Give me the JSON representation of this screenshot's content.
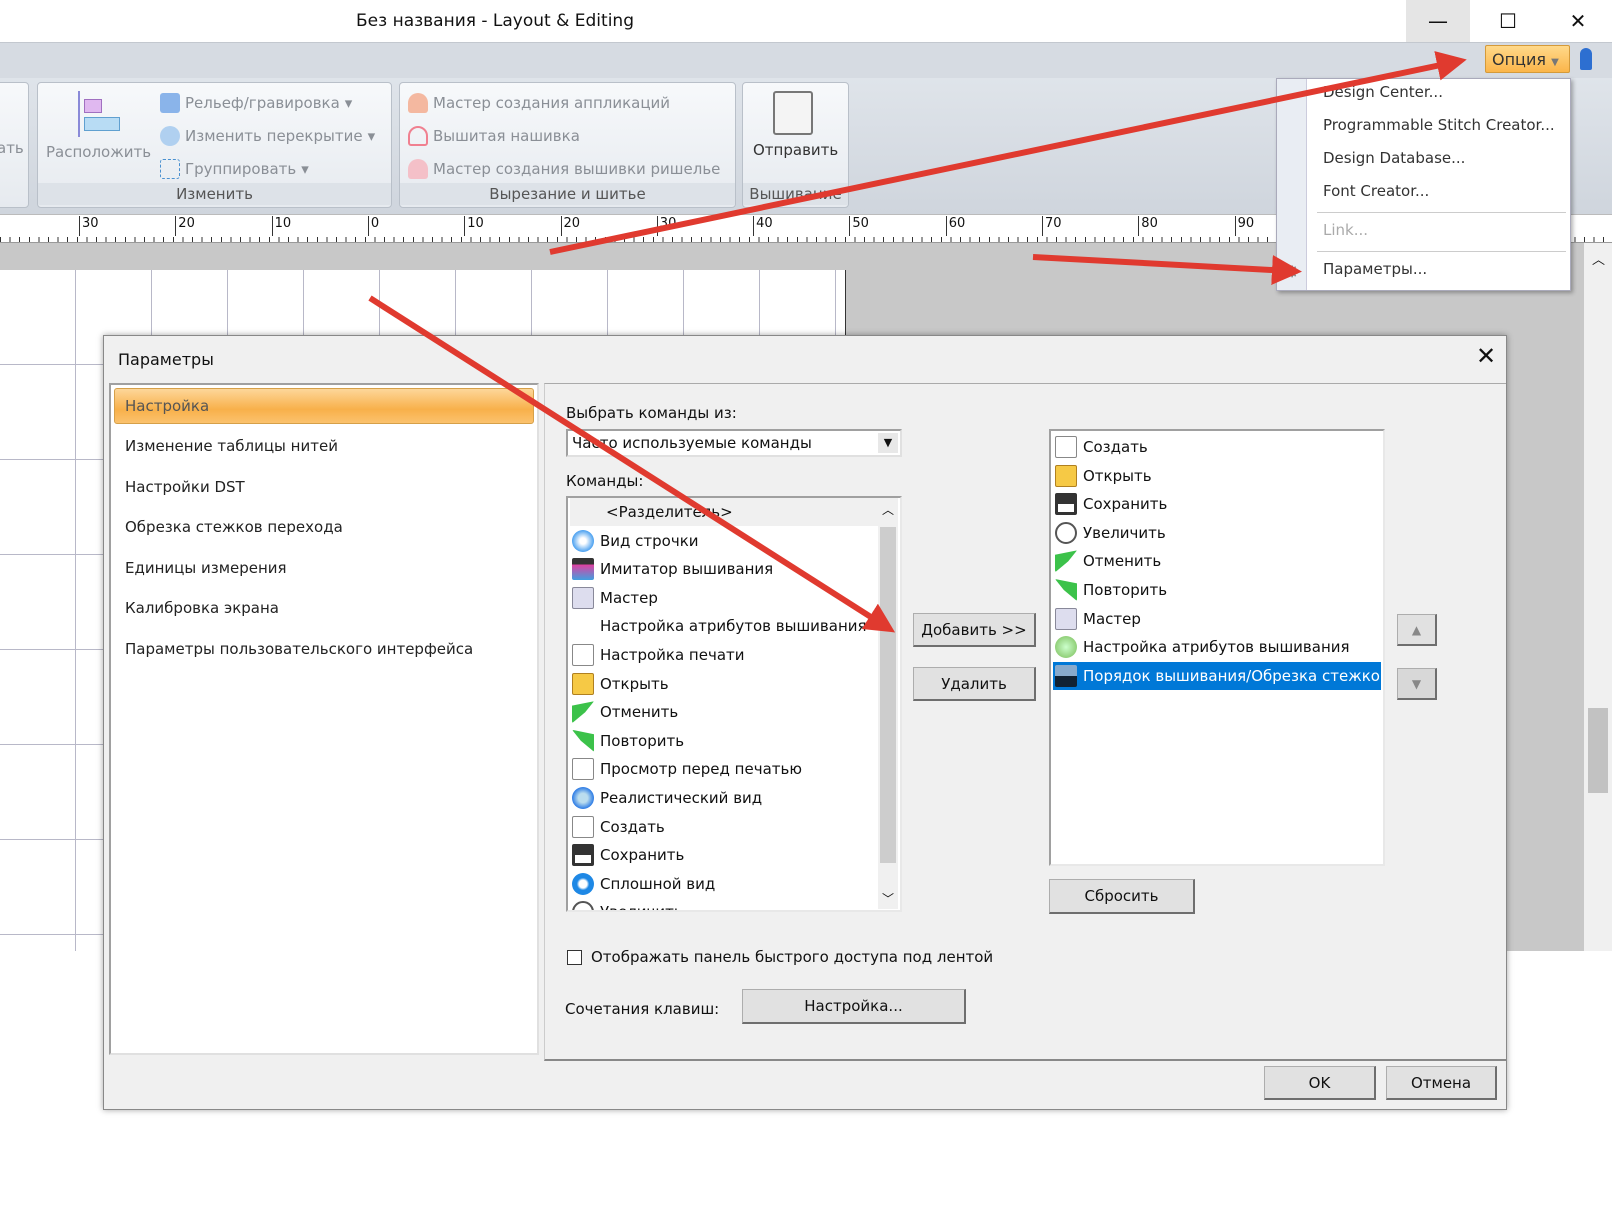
{
  "window": {
    "title": "Без названия - Layout & Editing",
    "minimize": "—",
    "maximize": "☐",
    "close": "✕"
  },
  "ribbon": {
    "partial_label": "ать",
    "arrange_label": "Расположить",
    "edit_items": [
      "Рельеф/гравировка",
      "Изменить перекрытие",
      "Группировать"
    ],
    "edit_group": "Изменить",
    "cut_items": [
      "Мастер создания аппликаций",
      "Вышитая нашивка",
      "Мастер создания вышивки ришелье"
    ],
    "cut_group": "Вырезание и шитье",
    "send_label": "Отправить",
    "send_group": "Вышивание",
    "option_button": "Опция"
  },
  "ruler": [
    "30",
    "20",
    "10",
    "0",
    "10",
    "20",
    "30",
    "40",
    "50",
    "60",
    "70",
    "80",
    "90"
  ],
  "menu": {
    "items": [
      "Design Center...",
      "Programmable Stitch Creator...",
      "Design Database...",
      "Font Creator..."
    ],
    "link": "Link...",
    "params": "Параметры..."
  },
  "dialog": {
    "title": "Параметры",
    "close": "✕",
    "nav": [
      "Настройка",
      "Изменение таблицы нитей",
      "Настройки DST",
      "Обрезка стежков перехода",
      "Единицы измерения",
      "Калибровка экрана",
      "Параметры пользовательского интерфейса"
    ],
    "choose_label": "Выбрать команды из:",
    "choose_value": "Часто используемые команды",
    "commands_label": "Команды:",
    "commands": [
      "<Разделитель>",
      "Вид строчки",
      "Имитатор вышивания",
      "Мастер",
      "Настройка атрибутов вышивания",
      "Настройка печати",
      "Открыть",
      "Отменить",
      "Повторить",
      "Просмотр перед печатью",
      "Реалистический вид",
      "Создать",
      "Сохранить",
      "Сплошной вид",
      "Увеличить"
    ],
    "add_button": "Добавить >>",
    "remove_button": "Удалить",
    "quick_access": [
      "Создать",
      "Открыть",
      "Сохранить",
      "Увеличить",
      "Отменить",
      "Повторить",
      "Мастер",
      "Настройка атрибутов вышивания",
      "Порядок вышивания/Обрезка стежков"
    ],
    "selected_index": 8,
    "reset_button": "Сбросить",
    "checkbox_label": "Отображать панель быстрого доступа под лентой",
    "checkbox_checked": false,
    "shortcuts_label": "Сочетания клавиш:",
    "shortcuts_button": "Настройка...",
    "ok_button": "OK",
    "cancel_button": "Отмена"
  },
  "colors": {
    "accent": "#0078d7",
    "highlight": "#f8b04a",
    "arrow": "#e03a2f"
  }
}
